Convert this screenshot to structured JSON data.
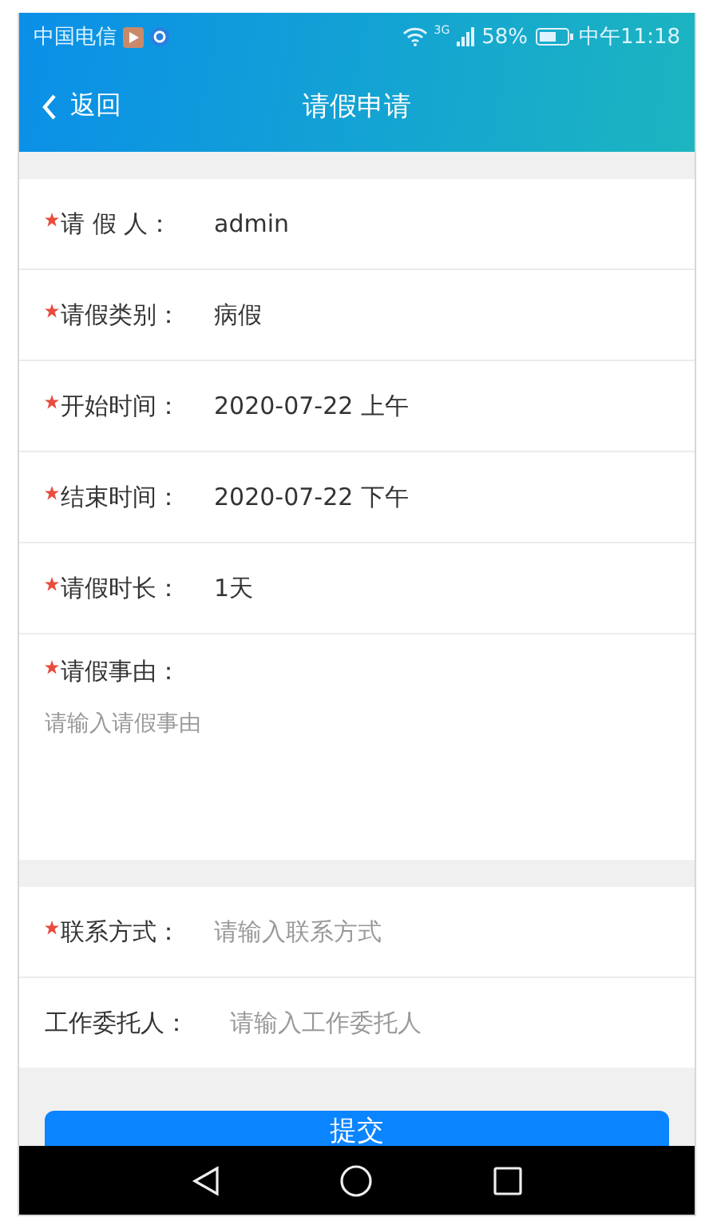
{
  "status_bar": {
    "carrier": "中国电信",
    "network": "3G",
    "battery": "58%",
    "time": "中午11:18"
  },
  "nav": {
    "back": "返回",
    "title": "请假申请"
  },
  "sections": [
    {
      "fields": [
        {
          "kind": "text",
          "label": "请 假 人：",
          "required": true,
          "value": "admin"
        },
        {
          "kind": "text",
          "label": "请假类别：",
          "required": true,
          "value": "病假"
        },
        {
          "kind": "text",
          "label": "开始时间：",
          "required": true,
          "value": "2020-07-22 上午"
        },
        {
          "kind": "text",
          "label": "结束时间：",
          "required": true,
          "value": "2020-07-22 下午"
        },
        {
          "kind": "text",
          "label": "请假时长：",
          "required": true,
          "value": "1天"
        },
        {
          "kind": "textarea",
          "label": "请假事由：",
          "required": true,
          "placeholder": "请输入请假事由"
        }
      ]
    },
    {
      "fields": [
        {
          "kind": "input",
          "label": "联系方式：",
          "required": true,
          "placeholder": "请输入联系方式"
        },
        {
          "kind": "input",
          "label": "工作委托人：",
          "required": false,
          "placeholder": "请输入工作委托人"
        }
      ]
    }
  ],
  "submit": "提交"
}
